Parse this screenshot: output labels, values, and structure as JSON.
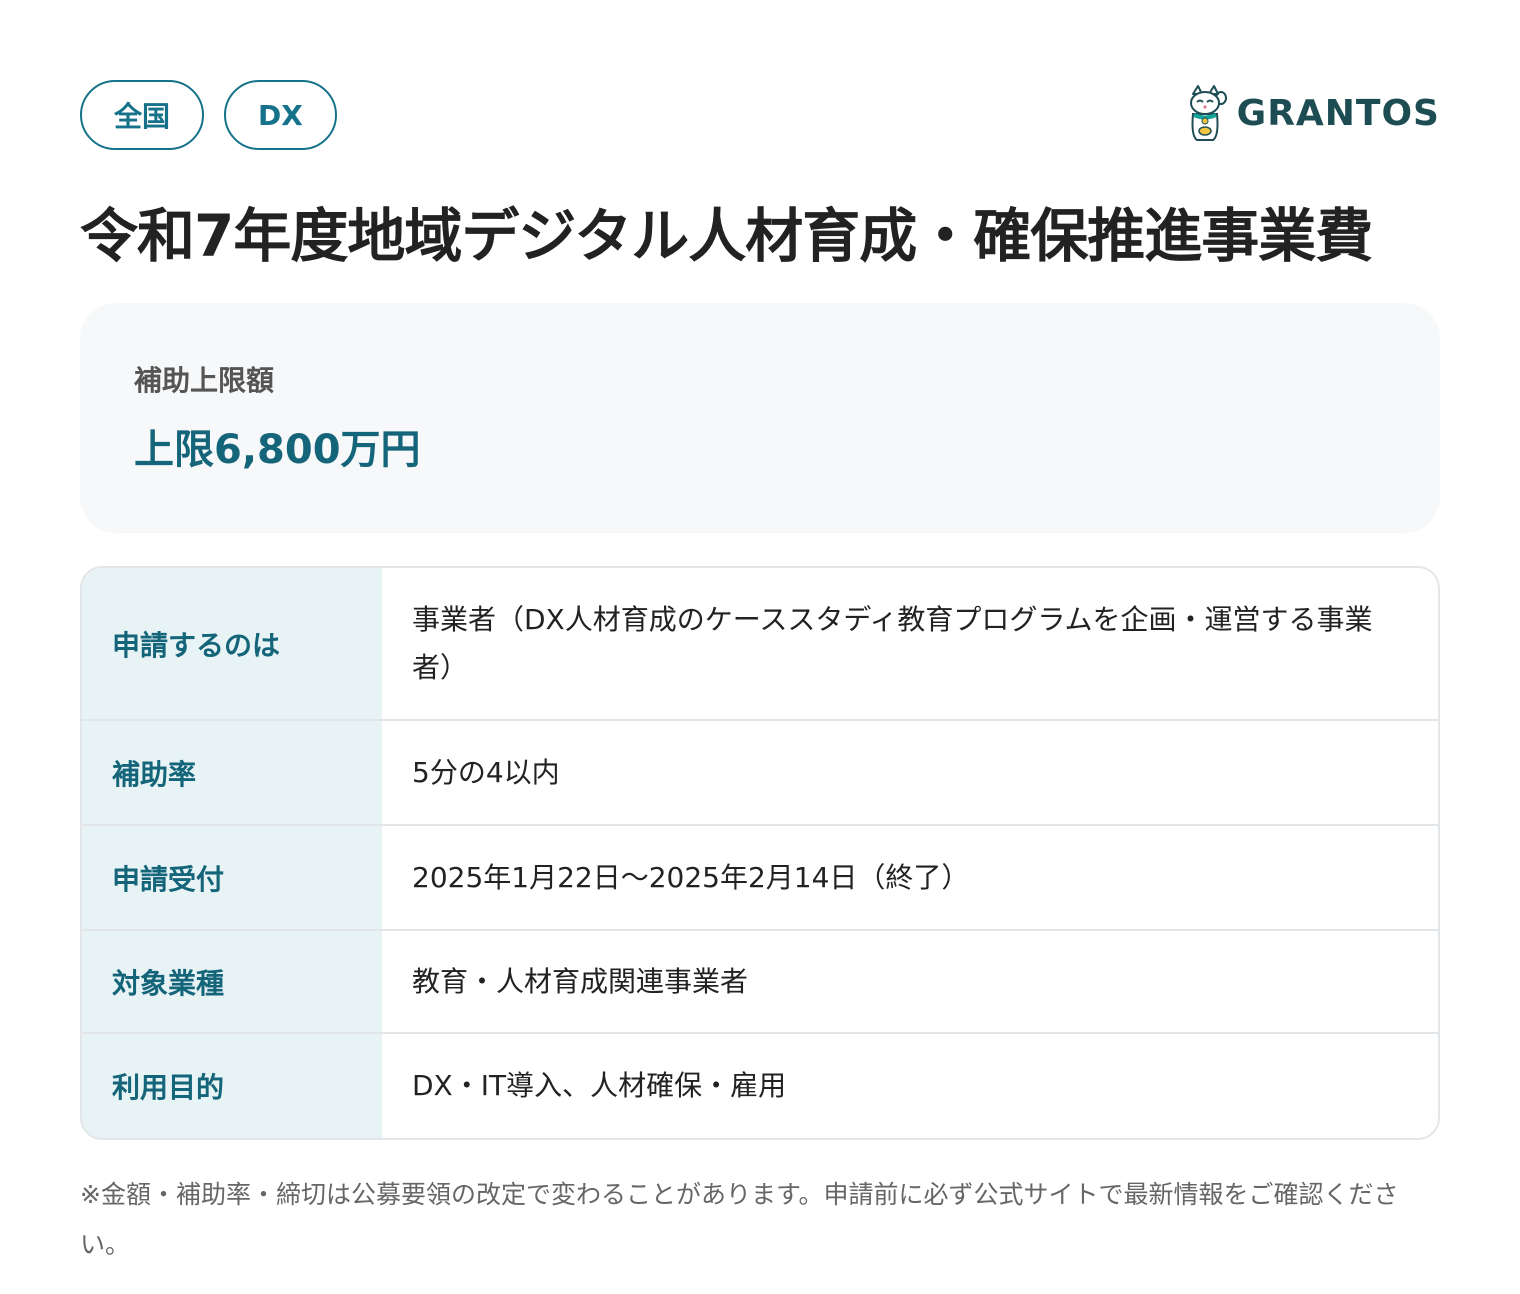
{
  "tags": [
    "全国",
    "DX"
  ],
  "logo": {
    "text": "GRANTOS",
    "icon": "lucky-cat-icon"
  },
  "title": "令和7年度地域デジタル人材育成・確保推進事業費",
  "amount": {
    "label": "補助上限額",
    "value": "上限6,800万円"
  },
  "details": [
    {
      "label": "申請するのは",
      "value": "事業者（DX人材育成のケーススタディ教育プログラムを企画・運営する事業者）"
    },
    {
      "label": "補助率",
      "value": "5分の4以内"
    },
    {
      "label": "申請受付",
      "value": "2025年1月22日〜2025年2月14日（終了）"
    },
    {
      "label": "対象業種",
      "value": "教育・人材育成関連事業者"
    },
    {
      "label": "利用目的",
      "value": "DX・IT導入、人材確保・雇用"
    }
  ],
  "note": "※金額・補助率・締切は公募要領の改定で変わることがあります。申請前に必ず公式サイトで最新情報をご確認ください。",
  "colors": {
    "accent": "#15728a",
    "accent_dark": "#15657a",
    "row_header_bg": "#e8f3f6",
    "card_bg": "#f6f8f9",
    "border": "#e3e6e8"
  }
}
